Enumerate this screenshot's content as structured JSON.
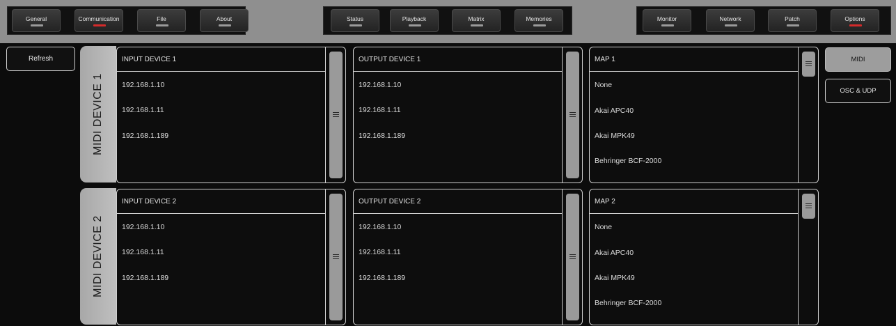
{
  "toolbar": {
    "buttons": [
      {
        "label": "General",
        "indicator": "gray"
      },
      {
        "label": "Communication",
        "indicator": "red"
      },
      {
        "label": "File",
        "indicator": "gray"
      },
      {
        "label": "About",
        "indicator": "gray"
      },
      {
        "label": "Status",
        "indicator": "gray"
      },
      {
        "label": "Playback",
        "indicator": "gray"
      },
      {
        "label": "Matrix",
        "indicator": "gray"
      },
      {
        "label": "Memories",
        "indicator": "gray"
      },
      {
        "label": "Monitor",
        "indicator": "gray"
      },
      {
        "label": "Network",
        "indicator": "gray"
      },
      {
        "label": "Patch",
        "indicator": "gray"
      },
      {
        "label": "Options",
        "indicator": "red"
      }
    ]
  },
  "left": {
    "refresh_label": "Refresh"
  },
  "devices": [
    {
      "tab_label": "MIDI DEVICE 1",
      "input": {
        "title": "INPUT DEVICE 1",
        "items": [
          "192.168.1.10",
          "192.168.1.11",
          "192.168.1.189"
        ]
      },
      "output": {
        "title": "OUTPUT DEVICE 1",
        "items": [
          "192.168.1.10",
          "192.168.1.11",
          "192.168.1.189"
        ]
      },
      "map": {
        "title": "MAP 1",
        "items": [
          "None",
          "Akai APC40",
          "Akai MPK49",
          "Behringer BCF-2000"
        ]
      }
    },
    {
      "tab_label": "MIDI DEVICE 2",
      "input": {
        "title": "INPUT DEVICE 2",
        "items": [
          "192.168.1.10",
          "192.168.1.11",
          "192.168.1.189"
        ]
      },
      "output": {
        "title": "OUTPUT DEVICE 2",
        "items": [
          "192.168.1.10",
          "192.168.1.11",
          "192.168.1.189"
        ]
      },
      "map": {
        "title": "MAP 2",
        "items": [
          "None",
          "Akai APC40",
          "Akai MPK49",
          "Behringer BCF-2000"
        ]
      }
    }
  ],
  "side_tabs": {
    "active": "MIDI",
    "inactive": "OSC & UDP"
  },
  "colors": {
    "indicator_red": "#d42b2b",
    "indicator_gray": "#9a9a9a",
    "tab_bg": "#b4b4b4"
  }
}
